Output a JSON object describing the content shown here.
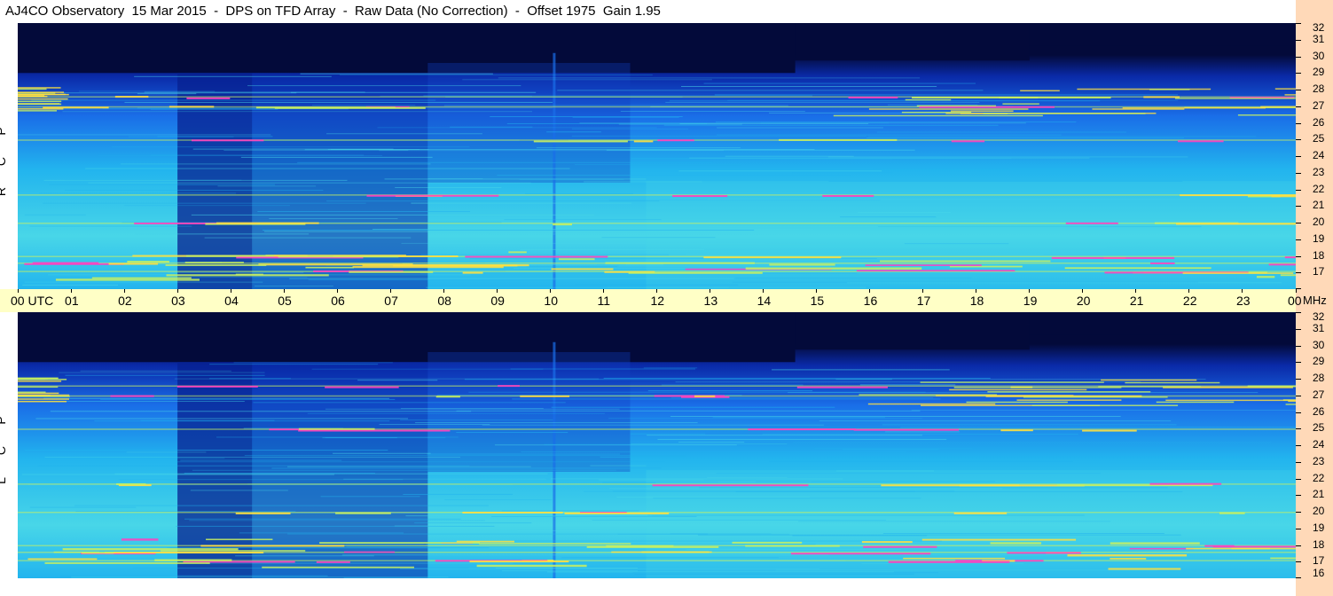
{
  "title": "AJ4CO Observatory  15 Mar 2015  -  DPS on TFD Array  -  Raw Data (No Correction)  -  Offset 1975  Gain 1.95",
  "colors": {
    "background_dark": "#030a3a",
    "deep_blue": "#0a2aa8",
    "mid_blue": "#1a6ee8",
    "cyan": "#22b4ee",
    "light_cyan": "#48d6e8",
    "green_yellow": "#c8f060",
    "yellow": "#ffe040",
    "magenta": "#ff40c0",
    "axis_band": "#ffffc6",
    "freq_strip": "#ffd9b8"
  },
  "panels": [
    {
      "id": "rcp",
      "label_letters": [
        "P",
        "C",
        "R"
      ]
    },
    {
      "id": "lcp",
      "label_letters": [
        "P",
        "C",
        "L"
      ]
    }
  ],
  "time_axis": {
    "labels": [
      "00 UTC",
      "01",
      "02",
      "03",
      "04",
      "05",
      "06",
      "07",
      "08",
      "09",
      "10",
      "11",
      "12",
      "13",
      "14",
      "15",
      "16",
      "17",
      "18",
      "19",
      "20",
      "21",
      "22",
      "23",
      "00"
    ]
  },
  "freq_axis": {
    "labels": [
      "32",
      "31",
      "30",
      "29",
      "28",
      "27",
      "26",
      "25",
      "24",
      "23",
      "22",
      "21",
      "20",
      "19",
      "18",
      "17",
      "16"
    ],
    "unit": "MHz"
  },
  "chart_data": {
    "type": "heatmap",
    "title": "AJ4CO Observatory  15 Mar 2015  -  DPS on TFD Array  -  Raw Data (No Correction)  -  Offset 1975  Gain 1.95",
    "xlabel": "UTC",
    "ylabel": "MHz",
    "x_range_hours_utc": [
      0,
      24
    ],
    "y_range_mhz": [
      16,
      32
    ],
    "panels": [
      "RCP",
      "LCP"
    ],
    "features": {
      "night_absorption_hours": [
        3.0,
        7.7
      ],
      "dark_upper_band_mhz_above": 29,
      "strong_interference_lines_mhz": [
        17.1,
        17.6,
        18.0,
        20.0,
        21.7,
        25.0,
        27.0,
        27.6
      ],
      "vertical_burst_hour": 10.05
    }
  }
}
